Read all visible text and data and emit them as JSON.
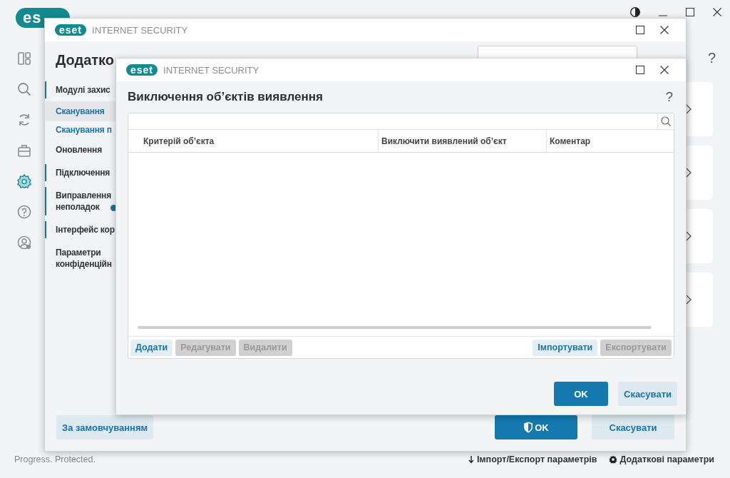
{
  "main_window": {
    "logo": "es",
    "nav": [
      {
        "kind": "overview",
        "selected": false
      },
      {
        "kind": "scan",
        "selected": false
      },
      {
        "kind": "update",
        "selected": false
      },
      {
        "kind": "tools",
        "selected": false
      },
      {
        "kind": "setup",
        "selected": true
      },
      {
        "kind": "help",
        "selected": false
      },
      {
        "kind": "account",
        "selected": false
      }
    ],
    "help": "?",
    "status": "Progress. Protected.",
    "links": [
      {
        "kind": "import",
        "label": "Імпорт/Експорт параметрів"
      },
      {
        "kind": "settings",
        "label": "Додаткові параметри"
      }
    ]
  },
  "settings_window": {
    "logo": "eset",
    "title": "INTERNET SECURITY",
    "heading": "Додатко",
    "sidebar": [
      {
        "label": "Модулі захис",
        "marked": true,
        "badge": false,
        "children": [
          {
            "label": "Сканування",
            "selected": true
          },
          {
            "label": "Сканування п",
            "selected": false
          }
        ]
      },
      {
        "label": "Оновлення",
        "marked": false,
        "badge": false
      },
      {
        "label": "Підключення",
        "marked": true,
        "badge": false
      },
      {
        "label": "Виправлення неполадок",
        "marked": true,
        "badge": true
      },
      {
        "label": "Інтерфейс кор",
        "marked": true,
        "badge": false
      },
      {
        "label": "Параметри конфіденційн",
        "marked": false,
        "badge": false
      }
    ],
    "buttons": [
      {
        "label": "За замовчуванням",
        "kind": "secondary"
      },
      {
        "label": "OK",
        "kind": "primary"
      },
      {
        "label": "Скасувати",
        "kind": "secondary"
      }
    ]
  },
  "dialog": {
    "logo": "eset",
    "title": "INTERNET SECURITY",
    "heading": "Виключення об’єктів виявлення",
    "help": "?",
    "table": {
      "columns": [
        "Критерій об’єкта",
        "Виключити виявлений об’єкт",
        "Коментар"
      ]
    },
    "toolbar_left": [
      {
        "label": "Додати",
        "disabled": false
      },
      {
        "label": "Редагувати",
        "disabled": true
      },
      {
        "label": "Видалити",
        "disabled": true
      }
    ],
    "toolbar_right": [
      {
        "label": "Імпортувати",
        "disabled": false
      },
      {
        "label": "Експортувати",
        "disabled": true
      }
    ],
    "buttons": [
      {
        "label": "OK",
        "kind": "primary"
      },
      {
        "label": "Скасувати",
        "kind": "secondary"
      }
    ]
  }
}
